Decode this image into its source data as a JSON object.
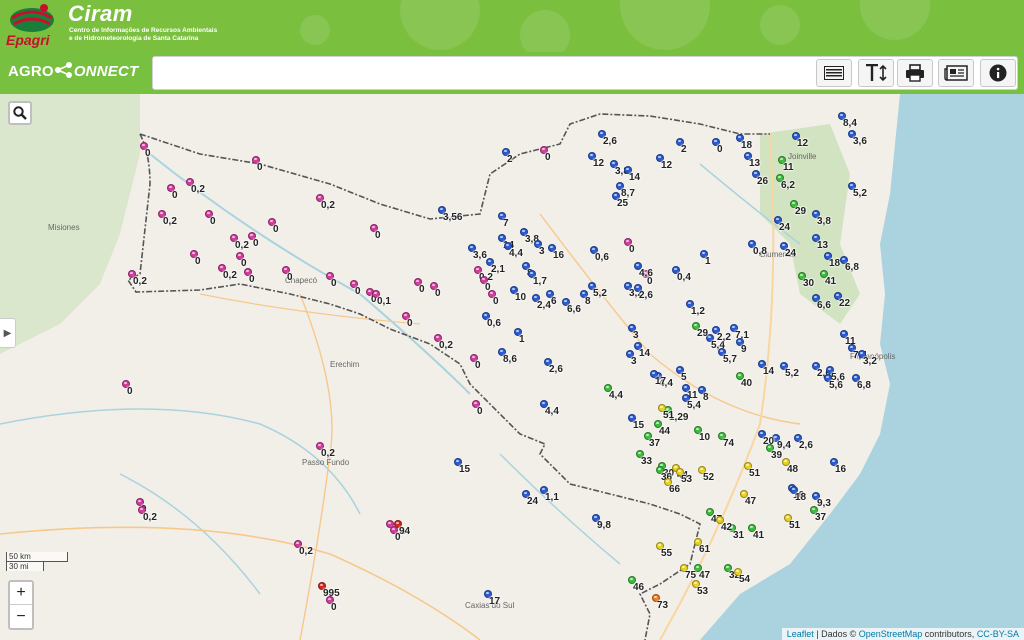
{
  "header": {
    "brand": "Epagri",
    "title": "Ciram",
    "subtitle": "Centro de Informações de Recursos Ambientais e de Hidrometeorologia de Santa Catarina"
  },
  "toolbar": {
    "agro": "AGRO",
    "connect": "ONNECT",
    "search_placeholder": "",
    "buttons": [
      "list-icon",
      "text-size-icon",
      "print-icon",
      "newspaper-icon",
      "info-icon"
    ]
  },
  "map": {
    "cities": [
      "Misiones",
      "Chapecó",
      "Erechim",
      "Passo Fundo",
      "Caxias do Sul",
      "Joinville",
      "Blumenau",
      "Florianópolis"
    ],
    "scale_km": "50 km",
    "scale_mi": "30 mi",
    "zoom_in": "+",
    "zoom_out": "−",
    "attribution": {
      "leaflet": "Leaflet",
      "middle": " | Dados © ",
      "osm": "OpenStreetMap",
      "contrib": " contributors, ",
      "license": "CC-BY-SA"
    }
  },
  "colors": {
    "pink": "#d63a9f",
    "blue": "#2a5bd7",
    "green": "#3bbf3b",
    "yellow": "#e8d21d",
    "orange": "#f07a1a",
    "red": "#d9261c"
  },
  "stations": [
    {
      "c": "pink",
      "v": "0"
    },
    {
      "c": "pink",
      "v": "0,2"
    },
    {
      "c": "pink",
      "v": "0"
    },
    {
      "c": "pink",
      "v": "0,2"
    },
    {
      "c": "pink",
      "v": "0"
    },
    {
      "c": "pink",
      "v": "0,2"
    },
    {
      "c": "pink",
      "v": "0"
    },
    {
      "c": "pink",
      "v": "0"
    },
    {
      "c": "pink",
      "v": "0"
    },
    {
      "c": "pink",
      "v": "0"
    },
    {
      "c": "pink",
      "v": "0,2"
    },
    {
      "c": "pink",
      "v": "0"
    },
    {
      "c": "pink",
      "v": "0"
    },
    {
      "c": "pink",
      "v": "0,2"
    },
    {
      "c": "pink",
      "v": "0"
    },
    {
      "c": "pink",
      "v": "0"
    },
    {
      "c": "pink",
      "v": "0"
    },
    {
      "c": "pink",
      "v": "0"
    },
    {
      "c": "pink",
      "v": "0,1"
    },
    {
      "c": "pink",
      "v": "0"
    },
    {
      "c": "pink",
      "v": "0"
    },
    {
      "c": "pink",
      "v": "0"
    },
    {
      "c": "pink",
      "v": "0,2"
    },
    {
      "c": "pink",
      "v": "0"
    },
    {
      "c": "pink",
      "v": "0,2"
    },
    {
      "c": "pink",
      "v": "0"
    },
    {
      "c": "pink",
      "v": "0"
    },
    {
      "c": "pink",
      "v": "0"
    },
    {
      "c": "pink",
      "v": "0"
    },
    {
      "c": "pink",
      "v": "0"
    },
    {
      "c": "pink",
      "v": "0"
    },
    {
      "c": "pink",
      "v": "0,2"
    },
    {
      "c": "pink",
      "v": "0"
    },
    {
      "c": "pink",
      "v": "0"
    },
    {
      "c": "pink",
      "v": "0,2"
    },
    {
      "c": "pink",
      "v": "0,2"
    },
    {
      "c": "pink",
      "v": "0,2"
    },
    {
      "c": "blue",
      "v": "2"
    },
    {
      "c": "blue",
      "v": "2,6"
    },
    {
      "c": "blue",
      "v": "12"
    },
    {
      "c": "blue",
      "v": "3,8"
    },
    {
      "c": "blue",
      "v": "14"
    },
    {
      "c": "blue",
      "v": "2"
    },
    {
      "c": "blue",
      "v": "12"
    },
    {
      "c": "blue",
      "v": "0"
    },
    {
      "c": "blue",
      "v": "18"
    },
    {
      "c": "blue",
      "v": "13"
    },
    {
      "c": "blue",
      "v": "12"
    },
    {
      "c": "blue",
      "v": "8,4"
    },
    {
      "c": "blue",
      "v": "3,6"
    },
    {
      "c": "blue",
      "v": "26"
    },
    {
      "c": "blue",
      "v": "5,2"
    },
    {
      "c": "blue",
      "v": "3,56"
    },
    {
      "c": "blue",
      "v": "7"
    },
    {
      "c": "blue",
      "v": "14"
    },
    {
      "c": "blue",
      "v": "4,4"
    },
    {
      "c": "blue",
      "v": "3,8"
    },
    {
      "c": "blue",
      "v": "3"
    },
    {
      "c": "blue",
      "v": "16"
    },
    {
      "c": "blue",
      "v": "0,6"
    },
    {
      "c": "blue",
      "v": "3,6"
    },
    {
      "c": "blue",
      "v": "2,1"
    },
    {
      "c": "blue",
      "v": "8"
    },
    {
      "c": "blue",
      "v": "1,7"
    },
    {
      "c": "blue",
      "v": "4,6"
    },
    {
      "c": "blue",
      "v": "0,4"
    },
    {
      "c": "blue",
      "v": "1"
    },
    {
      "c": "blue",
      "v": "0,8"
    },
    {
      "c": "blue",
      "v": "24"
    },
    {
      "c": "blue",
      "v": "13"
    },
    {
      "c": "blue",
      "v": "24"
    },
    {
      "c": "blue",
      "v": "3,8"
    },
    {
      "c": "blue",
      "v": "18"
    },
    {
      "c": "blue",
      "v": "6,8"
    },
    {
      "c": "blue",
      "v": "6,6"
    },
    {
      "c": "blue",
      "v": "22"
    },
    {
      "c": "blue",
      "v": "10"
    },
    {
      "c": "blue",
      "v": "2,4"
    },
    {
      "c": "blue",
      "v": "6"
    },
    {
      "c": "blue",
      "v": "6,6"
    },
    {
      "c": "blue",
      "v": "8"
    },
    {
      "c": "blue",
      "v": "5,2"
    },
    {
      "c": "blue",
      "v": "3,2"
    },
    {
      "c": "blue",
      "v": "2,6"
    },
    {
      "c": "blue",
      "v": "1,2"
    },
    {
      "c": "blue",
      "v": "0,6"
    },
    {
      "c": "blue",
      "v": "1"
    },
    {
      "c": "blue",
      "v": "8,6"
    },
    {
      "c": "blue",
      "v": "2,6"
    },
    {
      "c": "blue",
      "v": "3"
    },
    {
      "c": "blue",
      "v": "14"
    },
    {
      "c": "blue",
      "v": "3"
    },
    {
      "c": "blue",
      "v": "4,4"
    },
    {
      "c": "blue",
      "v": "5"
    },
    {
      "c": "blue",
      "v": "11"
    },
    {
      "c": "blue",
      "v": "5,4"
    },
    {
      "c": "blue",
      "v": "8"
    },
    {
      "c": "blue",
      "v": "5,4"
    },
    {
      "c": "blue",
      "v": "2,2"
    },
    {
      "c": "blue",
      "v": "7,1"
    },
    {
      "c": "blue",
      "v": "9"
    },
    {
      "c": "blue",
      "v": "5,7"
    },
    {
      "c": "blue",
      "v": "17"
    },
    {
      "c": "blue",
      "v": "14"
    },
    {
      "c": "blue",
      "v": "11"
    },
    {
      "c": "blue",
      "v": "7,4"
    },
    {
      "c": "blue",
      "v": "3,2"
    },
    {
      "c": "blue",
      "v": "5,2"
    },
    {
      "c": "blue",
      "v": "2,6"
    },
    {
      "c": "blue",
      "v": "5,6"
    },
    {
      "c": "blue",
      "v": "5,6"
    },
    {
      "c": "blue",
      "v": "6,8"
    },
    {
      "c": "blue",
      "v": "4,4"
    },
    {
      "c": "blue",
      "v": "15"
    },
    {
      "c": "blue",
      "v": "9,4"
    },
    {
      "c": "blue",
      "v": "2,6"
    },
    {
      "c": "blue",
      "v": "16"
    },
    {
      "c": "blue",
      "v": "15"
    },
    {
      "c": "blue",
      "v": "24"
    },
    {
      "c": "blue",
      "v": "1,1"
    },
    {
      "c": "blue",
      "v": "9,8"
    },
    {
      "c": "blue",
      "v": "9,3"
    },
    {
      "c": "blue",
      "v": "16"
    },
    {
      "c": "blue",
      "v": "18"
    },
    {
      "c": "blue",
      "v": "17"
    },
    {
      "c": "blue",
      "v": "20"
    },
    {
      "c": "blue",
      "v": "8,7"
    },
    {
      "c": "blue",
      "v": "25"
    },
    {
      "c": "green",
      "v": "11"
    },
    {
      "c": "green",
      "v": "6,2"
    },
    {
      "c": "green",
      "v": "29"
    },
    {
      "c": "green",
      "v": "30"
    },
    {
      "c": "green",
      "v": "41"
    },
    {
      "c": "green",
      "v": "29"
    },
    {
      "c": "green",
      "v": "40"
    },
    {
      "c": "green",
      "v": "4,4"
    },
    {
      "c": "green",
      "v": "1,29"
    },
    {
      "c": "green",
      "v": "10"
    },
    {
      "c": "green",
      "v": "37"
    },
    {
      "c": "green",
      "v": "33"
    },
    {
      "c": "green",
      "v": "30"
    },
    {
      "c": "green",
      "v": "36"
    },
    {
      "c": "green",
      "v": "39"
    },
    {
      "c": "green",
      "v": "47"
    },
    {
      "c": "green",
      "v": "31"
    },
    {
      "c": "green",
      "v": "41"
    },
    {
      "c": "green",
      "v": "37"
    },
    {
      "c": "green",
      "v": "46"
    },
    {
      "c": "green",
      "v": "47"
    },
    {
      "c": "green",
      "v": "32"
    },
    {
      "c": "green",
      "v": "44"
    },
    {
      "c": "green",
      "v": "74"
    },
    {
      "c": "yellow",
      "v": "51"
    },
    {
      "c": "yellow",
      "v": "44"
    },
    {
      "c": "yellow",
      "v": "52"
    },
    {
      "c": "yellow",
      "v": "53"
    },
    {
      "c": "yellow",
      "v": "66"
    },
    {
      "c": "yellow",
      "v": "51"
    },
    {
      "c": "yellow",
      "v": "48"
    },
    {
      "c": "yellow",
      "v": "42"
    },
    {
      "c": "yellow",
      "v": "51"
    },
    {
      "c": "yellow",
      "v": "55"
    },
    {
      "c": "yellow",
      "v": "61"
    },
    {
      "c": "yellow",
      "v": "53"
    },
    {
      "c": "yellow",
      "v": "54"
    },
    {
      "c": "yellow",
      "v": "75"
    },
    {
      "c": "yellow",
      "v": "47"
    },
    {
      "c": "orange",
      "v": "73"
    },
    {
      "c": "red",
      "v": "995"
    },
    {
      "c": "red",
      "v": "94"
    },
    {
      "c": "pink",
      "v": "0,2"
    },
    {
      "c": "pink",
      "v": "0"
    },
    {
      "c": "pink",
      "v": "0"
    },
    {
      "c": "pink",
      "v": "0"
    },
    {
      "c": "pink",
      "v": "0"
    },
    {
      "c": "pink",
      "v": "0"
    }
  ]
}
